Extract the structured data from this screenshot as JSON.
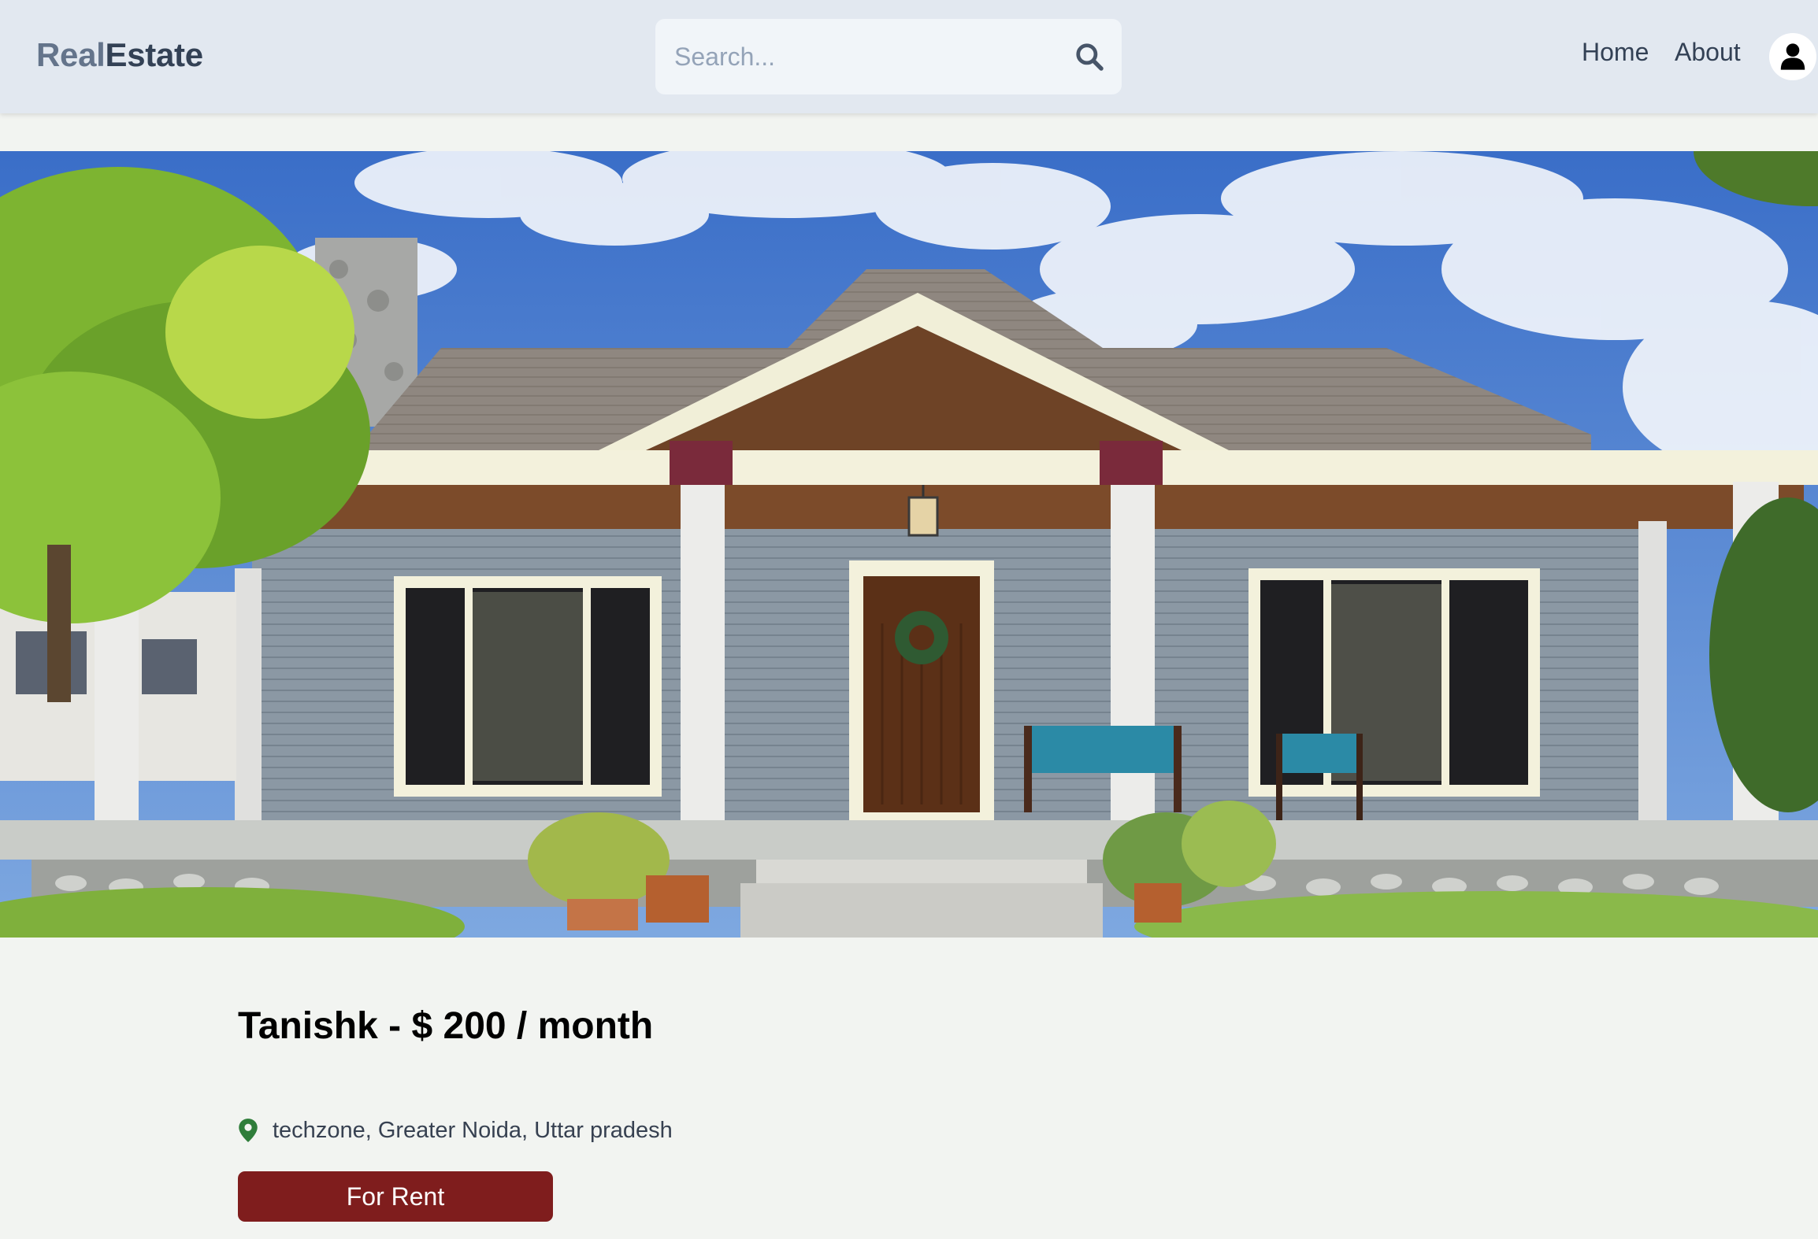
{
  "header": {
    "logo_part1": "Real",
    "logo_part2": "Estate",
    "search_placeholder": "Search...",
    "nav_home": "Home",
    "nav_about": "About"
  },
  "listing": {
    "title": "Tanishk - $ 200 / month",
    "location": "techzone, Greater Noida, Uttar pradesh",
    "type_badge": "For Rent"
  },
  "icons": {
    "search": "search-icon",
    "profile": "user-icon",
    "location": "map-pin-icon"
  },
  "colors": {
    "header_bg": "#e2e8f0",
    "page_bg": "#f2f4f1",
    "badge_bg": "#7f1d1d",
    "pin": "#2f7d3a"
  }
}
